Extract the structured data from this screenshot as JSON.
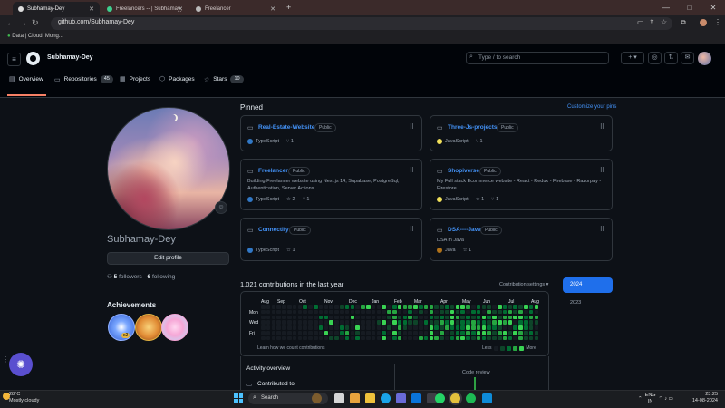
{
  "browser": {
    "tabs": [
      {
        "title": "Subhamay-Dey",
        "active": true
      },
      {
        "title": "Freelancers -- | Subhamay_Dey...",
        "active": false
      },
      {
        "title": "Freelancer",
        "active": false
      }
    ],
    "new_tab": "+",
    "url": "github.com/Subhamay-Dey",
    "bookmark": "Data | Cloud: Mong...",
    "controls": [
      "—",
      "□",
      "✕"
    ]
  },
  "header": {
    "username": "Subhamay-Dey",
    "search_placeholder": "Type / to search",
    "add_label": "+ ▾"
  },
  "nav": {
    "tabs": [
      {
        "label": "Overview",
        "icon": "book-icon"
      },
      {
        "label": "Repositories",
        "icon": "repo-icon",
        "count": "45"
      },
      {
        "label": "Projects",
        "icon": "table-icon"
      },
      {
        "label": "Packages",
        "icon": "package-icon"
      },
      {
        "label": "Stars",
        "icon": "star-icon",
        "count": "10"
      }
    ]
  },
  "profile": {
    "display_name": "Subhamay-Dey",
    "edit_button": "Edit profile",
    "followers_count": "5",
    "followers_label": "followers",
    "following_count": "6",
    "following_label": "following",
    "achievements_title": "Achievements",
    "badge_count": "x2"
  },
  "pinned": {
    "title": "Pinned",
    "customize": "Customize your pins",
    "public_label": "Public",
    "repos": [
      {
        "name": "Real-Estate-Website",
        "desc": "",
        "lang": "TypeScript",
        "lang_color": "#3178c6",
        "stars": "",
        "forks": "1"
      },
      {
        "name": "Three-Js-projects",
        "desc": "",
        "lang": "JavaScript",
        "lang_color": "#f1e05a",
        "stars": "",
        "forks": "1"
      },
      {
        "name": "Freelancer",
        "desc": "Building Freelancer website using Next.js 14, Supabase, PostgreSql, Authentication, Server Actions.",
        "lang": "TypeScript",
        "lang_color": "#3178c6",
        "stars": "2",
        "forks": "1"
      },
      {
        "name": "Shopiverse",
        "desc": "My Full stack Ecommerce website - React - Redux - Firebase - Razorpay - Firestore",
        "lang": "JavaScript",
        "lang_color": "#f1e05a",
        "stars": "1",
        "forks": "1"
      },
      {
        "name": "Connectify",
        "desc": "",
        "lang": "TypeScript",
        "lang_color": "#3178c6",
        "stars": "1",
        "forks": ""
      },
      {
        "name": "DSA----Java",
        "desc": "DSA in Java",
        "lang": "Java",
        "lang_color": "#b07219",
        "stars": "1",
        "forks": ""
      }
    ]
  },
  "contributions": {
    "title": "1,021 contributions in the last year",
    "settings": "Contribution settings ▾",
    "months": [
      "Aug",
      "Sep",
      "Oct",
      "Nov",
      "Dec",
      "Jan",
      "Feb",
      "Mar",
      "Apr",
      "May",
      "Jun",
      "Jul",
      "Aug"
    ],
    "days": [
      "Mon",
      "Wed",
      "Fri"
    ],
    "how_we_count": "Learn how we count contributions",
    "less": "Less",
    "more": "More",
    "years": [
      "2024",
      "2023"
    ],
    "colors": [
      "#161b22",
      "#0e4429",
      "#006d32",
      "#26a641",
      "#39d353"
    ]
  },
  "activity": {
    "title": "Activity overview",
    "contributed_to": "Contributed to",
    "code_review": "Code review"
  },
  "taskbar": {
    "temperature": "28°C",
    "weather": "Mostly cloudy",
    "search": "Search",
    "lang": "ENG",
    "region": "IN",
    "time": "23:25",
    "date": "14-08-2024"
  }
}
